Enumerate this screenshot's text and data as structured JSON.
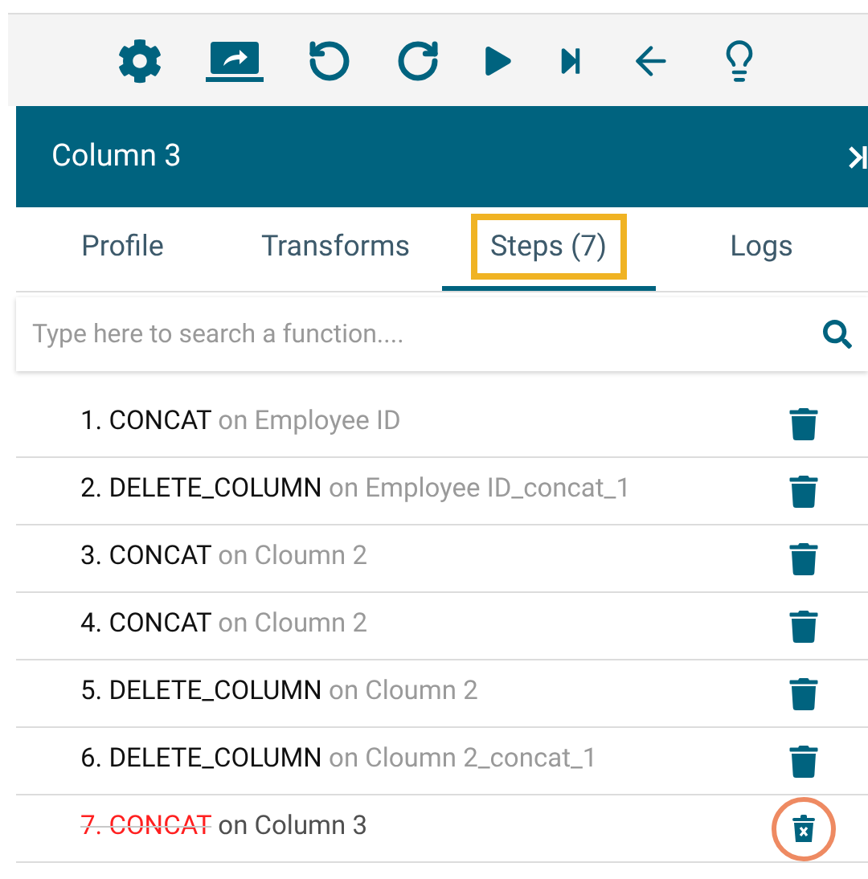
{
  "panel": {
    "title": "Column 3"
  },
  "tabs": [
    {
      "label": "Profile",
      "selected": false,
      "highlighted": false
    },
    {
      "label": "Transforms",
      "selected": false,
      "highlighted": false
    },
    {
      "label": "Steps (7)",
      "selected": true,
      "highlighted": true
    },
    {
      "label": "Logs",
      "selected": false,
      "highlighted": false
    }
  ],
  "search": {
    "placeholder": "Type here to search a function...."
  },
  "steps": [
    {
      "label": "1. CONCAT",
      "target": "on Employee ID",
      "deleted": false,
      "highlighted": false
    },
    {
      "label": "2. DELETE_COLUMN",
      "target": "on Employee ID_concat_1",
      "deleted": false,
      "highlighted": false
    },
    {
      "label": "3. CONCAT",
      "target": "on Cloumn 2",
      "deleted": false,
      "highlighted": false
    },
    {
      "label": "4. CONCAT",
      "target": "on Cloumn 2",
      "deleted": false,
      "highlighted": false
    },
    {
      "label": "5. DELETE_COLUMN",
      "target": "on Cloumn 2",
      "deleted": false,
      "highlighted": false
    },
    {
      "label": "6. DELETE_COLUMN",
      "target": "on Cloumn 2_concat_1",
      "deleted": false,
      "highlighted": false
    },
    {
      "label": "7. CONCAT",
      "target": "on Column 3",
      "deleted": true,
      "highlighted": true
    }
  ]
}
